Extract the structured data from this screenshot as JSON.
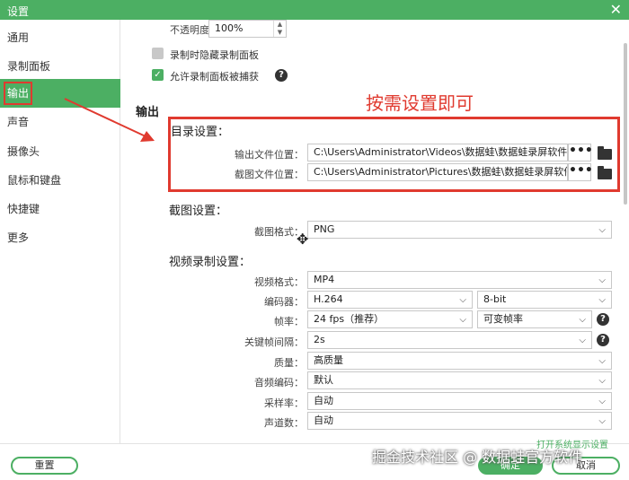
{
  "window": {
    "title": "设置",
    "close": "✕"
  },
  "sidebar": {
    "items": [
      {
        "label": "通用"
      },
      {
        "label": "录制面板"
      },
      {
        "label": "输出"
      },
      {
        "label": "声音"
      },
      {
        "label": "摄像头"
      },
      {
        "label": "鼠标和键盘"
      },
      {
        "label": "快捷键"
      },
      {
        "label": "更多"
      }
    ],
    "active": "输出"
  },
  "panel": {
    "opacity_label": "不透明度：",
    "opacity_value": "100%",
    "hide_panel_label": "录制时隐藏录制面板",
    "hide_panel_checked": false,
    "capture_panel_label": "允许录制面板被捕获",
    "capture_panel_checked": true
  },
  "output": {
    "heading": "输出",
    "annotation": "按需设置即可",
    "dir_section": "目录设置：",
    "output_path_label": "输出文件位置：",
    "output_path": "C:\\Users\\Administrator\\Videos\\数据蛙\\数据蛙录屏软件",
    "shot_path_label": "截图文件位置：",
    "shot_path": "C:\\Users\\Administrator\\Pictures\\数据蛙\\数据蛙录屏软件",
    "browse_label": "•••"
  },
  "screenshot": {
    "section": "截图设置：",
    "format_label": "截图格式：",
    "format_value": "PNG"
  },
  "video": {
    "section": "视频录制设置：",
    "format_label": "视频格式：",
    "format_value": "MP4",
    "encoder_label": "编码器：",
    "encoder_value": "H.264",
    "bitdepth_value": "8-bit",
    "fps_label": "帧率：",
    "fps_value": "24 fps（推荐）",
    "fps_mode_value": "可变帧率",
    "keyframe_label": "关键帧间隔：",
    "keyframe_value": "2s",
    "quality_label": "质量：",
    "quality_value": "高质量",
    "audio_codec_label": "音频编码：",
    "audio_codec_value": "默认",
    "sample_rate_label": "采样率：",
    "sample_rate_value": "自动",
    "channels_label": "声道数：",
    "channels_value": "自动"
  },
  "footer": {
    "reset": "重置",
    "ok": "确定",
    "cancel": "取消",
    "open_display_settings": "打开系统显示设置",
    "watermark": "掘金技术社区 @ 数据蛙官方软件"
  },
  "help_glyph": "?",
  "chevron_glyph": "⌵",
  "check_glyph": "✓",
  "colors": {
    "accent": "#4caf63",
    "annotation": "#e03a2f"
  }
}
